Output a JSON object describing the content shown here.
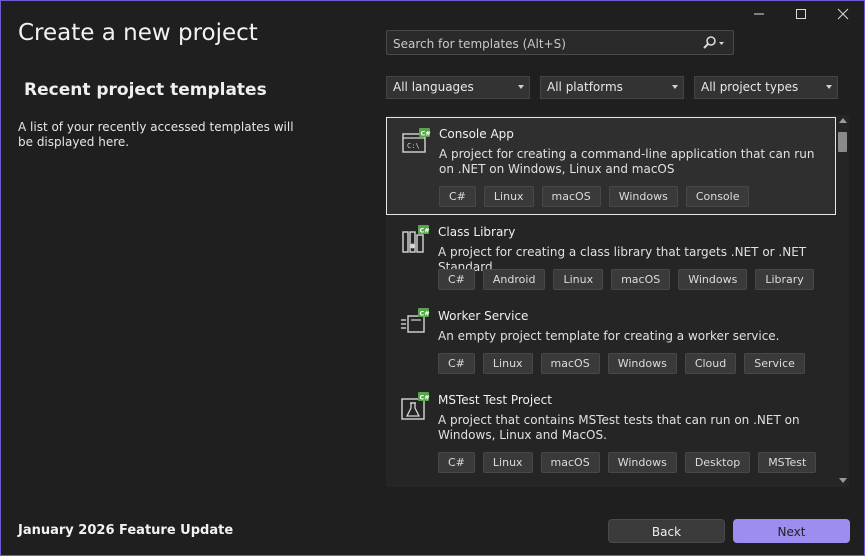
{
  "window": {
    "title": "Create a new project",
    "controls": {
      "minimize": "–",
      "maximize": "☐",
      "close": "✕"
    }
  },
  "left": {
    "heading": "Recent project templates",
    "description": "A list of your recently accessed templates will be displayed here."
  },
  "search": {
    "placeholder": "Search for templates (Alt+S)",
    "value": ""
  },
  "filters": {
    "language": "All languages",
    "platform": "All platforms",
    "project_type": "All project types"
  },
  "templates": [
    {
      "name": "Console App",
      "icon": "console-app-icon",
      "description": "A project for creating a command-line application that can run on .NET on Windows, Linux and macOS",
      "tags": [
        "C#",
        "Linux",
        "macOS",
        "Windows",
        "Console"
      ],
      "selected": true
    },
    {
      "name": "Class Library",
      "icon": "class-library-icon",
      "description": "A project for creating a class library that targets .NET or .NET Standard",
      "tags": [
        "C#",
        "Android",
        "Linux",
        "macOS",
        "Windows",
        "Library"
      ],
      "selected": false
    },
    {
      "name": "Worker Service",
      "icon": "worker-service-icon",
      "description": "An empty project template for creating a worker service.",
      "tags": [
        "C#",
        "Linux",
        "macOS",
        "Windows",
        "Cloud",
        "Service"
      ],
      "selected": false
    },
    {
      "name": "MSTest Test Project",
      "icon": "mstest-icon",
      "description": "A project that contains MSTest tests that can run on .NET on Windows, Linux and MacOS.",
      "tags": [
        "C#",
        "Linux",
        "macOS",
        "Windows",
        "Desktop",
        "MSTest"
      ],
      "selected": false
    }
  ],
  "footer": {
    "update_label": "January 2026 Feature Update",
    "back_label": "Back",
    "next_label": "Next"
  },
  "colors": {
    "background": "#1f1f1f",
    "accent": "#9d8df1",
    "csharp_badge": "#57a64a"
  }
}
